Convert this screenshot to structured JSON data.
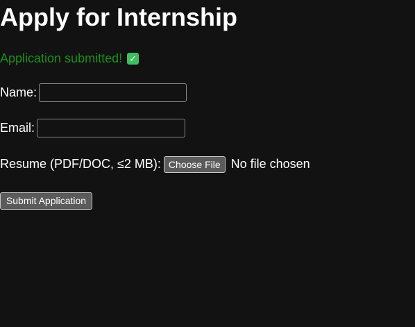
{
  "page": {
    "title": "Apply for Internship",
    "status_message": "Application submitted!",
    "status_icon": "check-mark-button-icon",
    "status_color": "#1a8f1a"
  },
  "form": {
    "name_label": "Name:",
    "name_value": "",
    "email_label": "Email:",
    "email_value": "",
    "resume_label": "Resume (PDF/DOC, ≤2 MB):",
    "choose_file_label": "Choose File",
    "no_file_text": "No file chosen",
    "submit_label": "Submit Application"
  },
  "colors": {
    "background": "#121212",
    "text": "#ffffff",
    "button_bg": "#5b5b5b"
  }
}
